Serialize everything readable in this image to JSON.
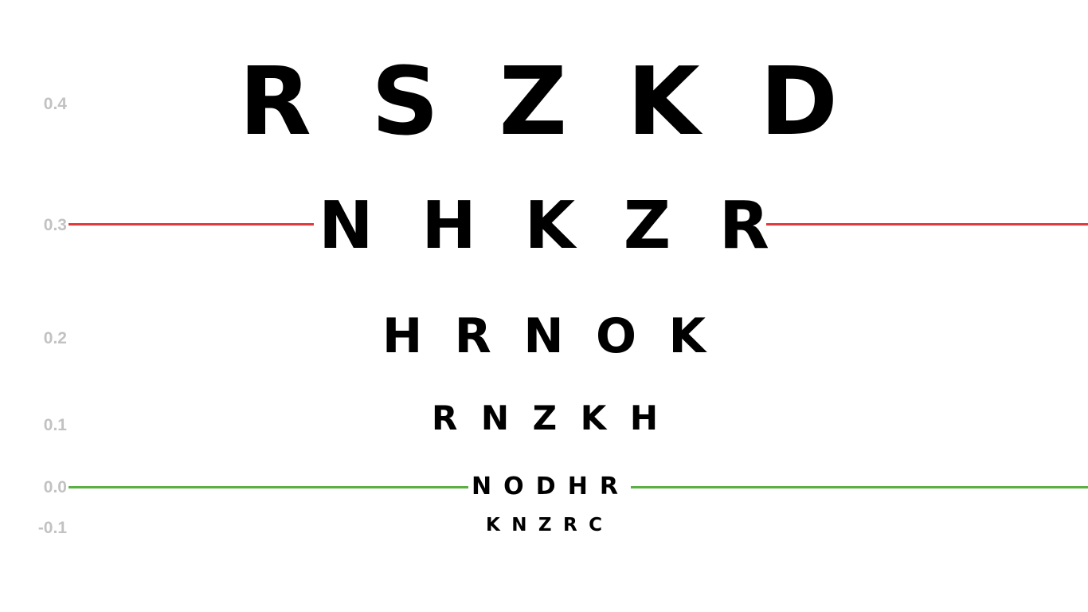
{
  "colors": {
    "background": "#ffffff",
    "letters": "#000000",
    "labels": "#c2c2c2",
    "marker_line_top": "#e03a3a",
    "marker_line_bottom": "#5cb043"
  },
  "rows": [
    {
      "label": "0.4",
      "letters": [
        "R",
        "S",
        "Z",
        "K",
        "D"
      ]
    },
    {
      "label": "0.3",
      "letters": [
        "N",
        "H",
        "K",
        "Z",
        "R"
      ]
    },
    {
      "label": "0.2",
      "letters": [
        "H",
        "R",
        "N",
        "O",
        "K"
      ]
    },
    {
      "label": "0.1",
      "letters": [
        "R",
        "N",
        "Z",
        "K",
        "H"
      ]
    },
    {
      "label": "0.0",
      "letters": [
        "N",
        "O",
        "D",
        "H",
        "R"
      ]
    },
    {
      "label": "-0.1",
      "letters": [
        "K",
        "N",
        "Z",
        "R",
        "C"
      ]
    }
  ],
  "marker_lines": [
    {
      "row_label": "0.3",
      "color": "#e03a3a"
    },
    {
      "row_label": "0.0",
      "color": "#5cb043"
    }
  ]
}
